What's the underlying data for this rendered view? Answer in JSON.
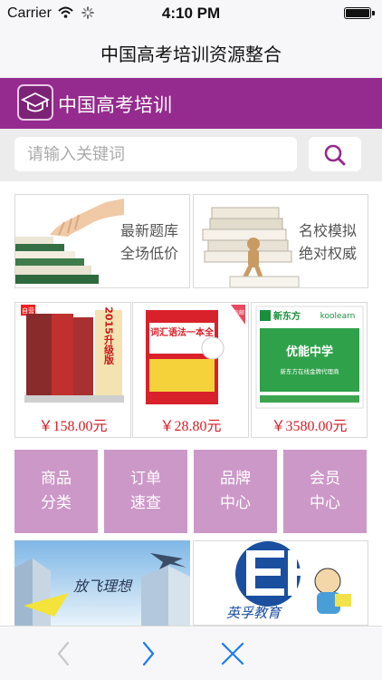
{
  "status_bar": {
    "carrier": "Carrier",
    "time": "4:10 PM"
  },
  "nav": {
    "title": "中国高考培训资源整合"
  },
  "brand": {
    "name": "中国高考培训",
    "color": "#952b8e",
    "logo_icon": "graduation-cap-icon"
  },
  "search": {
    "placeholder": "请输入关键词",
    "icon": "search-icon"
  },
  "promos": [
    {
      "line1": "最新题库",
      "line2": "全场低价",
      "image": "books-stairs-hand"
    },
    {
      "line1": "名校模拟",
      "line2": "绝对权威",
      "image": "wooden-figure-books"
    }
  ],
  "products": [
    {
      "price": "￥158.00元",
      "image_text": "2015升级版",
      "image_top": "自营"
    },
    {
      "price": "￥28.80元",
      "image_text": "词汇语法一本全",
      "image_top": "包邮"
    },
    {
      "price": "￥3580.00元",
      "image_text": "优能中学",
      "image_brand": "新东方",
      "image_brand2": "koolearn",
      "image_sub": "新东方在线金牌代理商"
    }
  ],
  "categories": [
    {
      "line1": "商品",
      "line2": "分类"
    },
    {
      "line1": "订单",
      "line2": "速查"
    },
    {
      "line1": "品牌",
      "line2": "中心"
    },
    {
      "line1": "会员",
      "line2": "中心"
    }
  ],
  "banners": [
    {
      "text": "放飞理想"
    },
    {
      "text": "英孚教育"
    }
  ],
  "toolbar": {
    "back_icon": "chevron-left-icon",
    "forward_icon": "chevron-right-icon",
    "close_icon": "close-icon"
  },
  "colors": {
    "accent": "#952b8e",
    "category_bg": "#cc98c8",
    "price": "#d3202a",
    "toolbar_icon": "#1a7cf0"
  }
}
